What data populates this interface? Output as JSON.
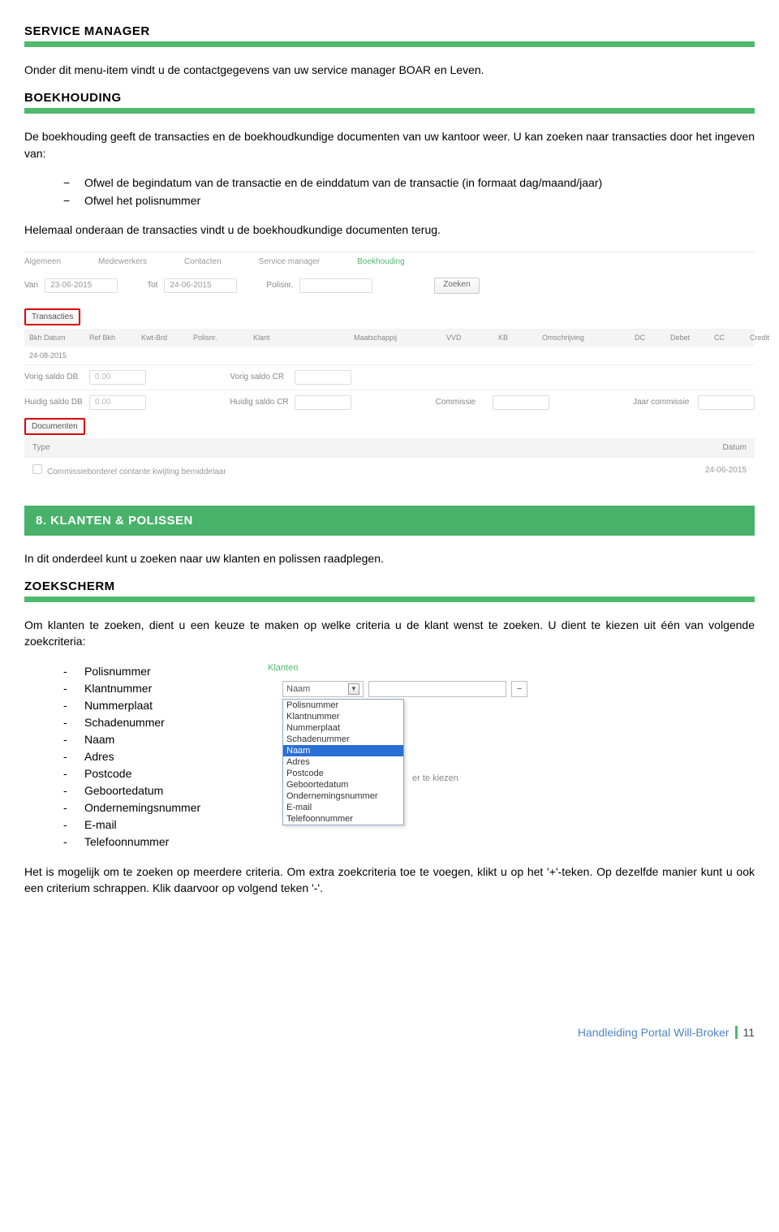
{
  "sections": {
    "service_manager": {
      "title": "SERVICE MANAGER",
      "text": "Onder dit menu-item vindt u de contactgegevens van uw service manager BOAR en Leven."
    },
    "boekhouding": {
      "title": "BOEKHOUDING",
      "intro": "De boekhouding geeft de transacties en de boekhoudkundige documenten van uw kantoor weer. U kan zoeken naar transacties door het ingeven van:",
      "bullets": [
        "Ofwel de begindatum van de transactie en de einddatum van de transactie (in formaat dag/maand/jaar)",
        "Ofwel het polisnummer"
      ],
      "outro": "Helemaal onderaan de transacties vindt u de boekhoudkundige documenten terug."
    },
    "klanten": {
      "banner": "8. KLANTEN & POLISSEN",
      "intro": "In dit onderdeel kunt u zoeken naar uw klanten en polissen raadplegen."
    },
    "zoekscherm": {
      "title": "ZOEKSCHERM",
      "intro": "Om klanten te zoeken, dient u een keuze te maken op welke criteria u de klant wenst te zoeken.  U dient te kiezen uit één van volgende zoekcriteria:",
      "criteria": [
        "Polisnummer",
        "Klantnummer",
        "Nummerplaat",
        "Schadenummer",
        "Naam",
        "Adres",
        "Postcode",
        "Geboortedatum",
        "Ondernemingsnummer",
        "E-mail",
        "Telefoonnummer"
      ],
      "outro": "Het is mogelijk om te zoeken op meerdere criteria. Om extra zoekcriteria toe te voegen, klikt u op het '+'-teken. Op dezelfde manier kunt u ook een criterium schrappen. Klik daarvoor op volgend teken '-'."
    }
  },
  "screenshot1": {
    "tabs": [
      "Algemeen",
      "Medewerkers",
      "Contacten",
      "Service manager",
      "Boekhouding"
    ],
    "filter": {
      "van_lbl": "Van",
      "van": "23-06-2015",
      "tot_lbl": "Tot",
      "tot": "24-06-2015",
      "polis_lbl": "Polisnr.",
      "polis": "",
      "zoeken": "Zoeken"
    },
    "transacties_btn": "Transacties",
    "headers": [
      "Bkh Datum",
      "Ref Bkh",
      "Kwt-Brd",
      "Polisnr.",
      "Klant",
      "Maatschappij",
      "VVD",
      "KB",
      "Omschrijving",
      "DC",
      "Debet",
      "CC",
      "Credit"
    ],
    "row": [
      "24-08-2015",
      "",
      "",
      "",
      "",
      "",
      "",
      "",
      "",
      "",
      "",
      "",
      ""
    ],
    "saldo1": {
      "l1": "Vorig saldo DB",
      "v1": "0.00",
      "l2": "Vorig saldo CR",
      "v2": ""
    },
    "saldo2": {
      "l1": "Huidig saldo DB",
      "v1": "0.00",
      "l2": "Huidig saldo CR",
      "v2": "",
      "l3": "Commissie",
      "v3": "",
      "l4": "Jaar commissie",
      "v4": ""
    },
    "documenten_btn": "Documenten",
    "doc_head": {
      "type": "Type",
      "datum": "Datum"
    },
    "doc_row": {
      "type": "Commissieborderel contante kwijting bemiddelaar",
      "datum": "24-06-2015"
    }
  },
  "dropdown_shot": {
    "title": "Klanten",
    "selected": "Naam",
    "hint": "er te kiezen",
    "options": [
      "Polisnummer",
      "Klantnummer",
      "Nummerplaat",
      "Schadenummer",
      "Naam",
      "Adres",
      "Postcode",
      "Geboortedatum",
      "Ondernemingsnummer",
      "E-mail",
      "Telefoonnummer"
    ]
  },
  "footer": {
    "text": "Handleiding Portal Will-Broker",
    "page": "11"
  }
}
